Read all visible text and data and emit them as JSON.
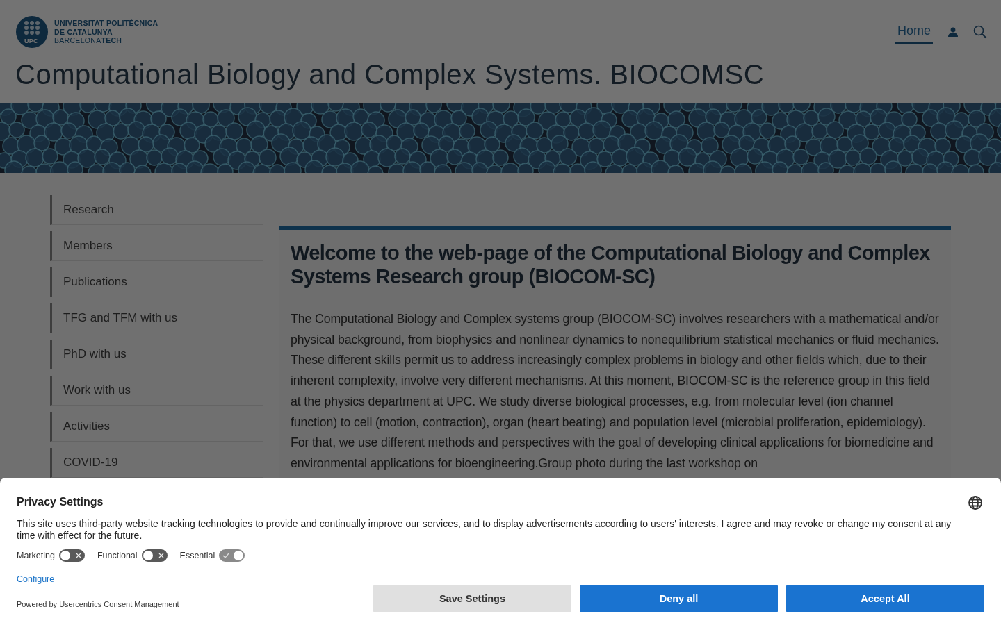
{
  "header": {
    "logo": {
      "badge": "UPC",
      "lines": [
        "UNIVERSITAT POLITÈCNICA",
        "DE CATALUNYA"
      ],
      "last_line_light": "BARCELONA",
      "last_line_bold": "TECH"
    },
    "nav": [
      {
        "label": "Home",
        "selected": true
      }
    ],
    "site_title": "Computational Biology and Complex Systems. BIOCOMSC"
  },
  "sidebar": {
    "items": [
      {
        "label": "Research"
      },
      {
        "label": "Members"
      },
      {
        "label": "Publications"
      },
      {
        "label": "TFG and TFM with us"
      },
      {
        "label": "PhD with us"
      },
      {
        "label": "Work with us"
      },
      {
        "label": "Activities"
      },
      {
        "label": "COVID-19"
      }
    ]
  },
  "article": {
    "heading": "Welcome to the web-page of the Computational Biology and Complex Systems Research group (BIOCOM-SC)",
    "body": "The Computational Biology and Complex systems group (BIOCOM-SC) involves researchers with a mathematical and/or physical background, from biophysics and nonlinear dynamics to nonequilibrium statistical mechanics or fluid mechanics. These different skills permit us to address increasingly complex problems in biology and other fields which, due to their inherent complexity, involve very different mechanisms. At this moment, BIOCOM-SC is the reference group in this field at the physics department at UPC. We study diverse biological processes, e.g. from molecular level (ion channel function) to cell (motion, contraction), organ (heart beating) and population level (microbial proliferation, epidemiology). For that, we use different methods and perspectives with the goal of developing clinical applications for biomedicine and environmental applications for bioengineering.Group photo during the last workshop on"
  },
  "consent": {
    "title": "Privacy Settings",
    "text": "This site uses third-party website tracking technologies to provide and continually improve our services, and to display advertisements according to users' interests. I agree and may revoke or change my consent at any time with effect for the future.",
    "toggles": [
      {
        "label": "Marketing",
        "checked": false,
        "disabled": false
      },
      {
        "label": "Functional",
        "checked": false,
        "disabled": false
      },
      {
        "label": "Essential",
        "checked": true,
        "disabled": true
      }
    ],
    "configure": "Configure",
    "powered_by": "Powered by Usercentrics Consent Management",
    "buttons": [
      {
        "label": "Save Settings",
        "kind": "secondary"
      },
      {
        "label": "Deny all",
        "kind": "primary"
      },
      {
        "label": "Accept All",
        "kind": "primary"
      }
    ]
  }
}
